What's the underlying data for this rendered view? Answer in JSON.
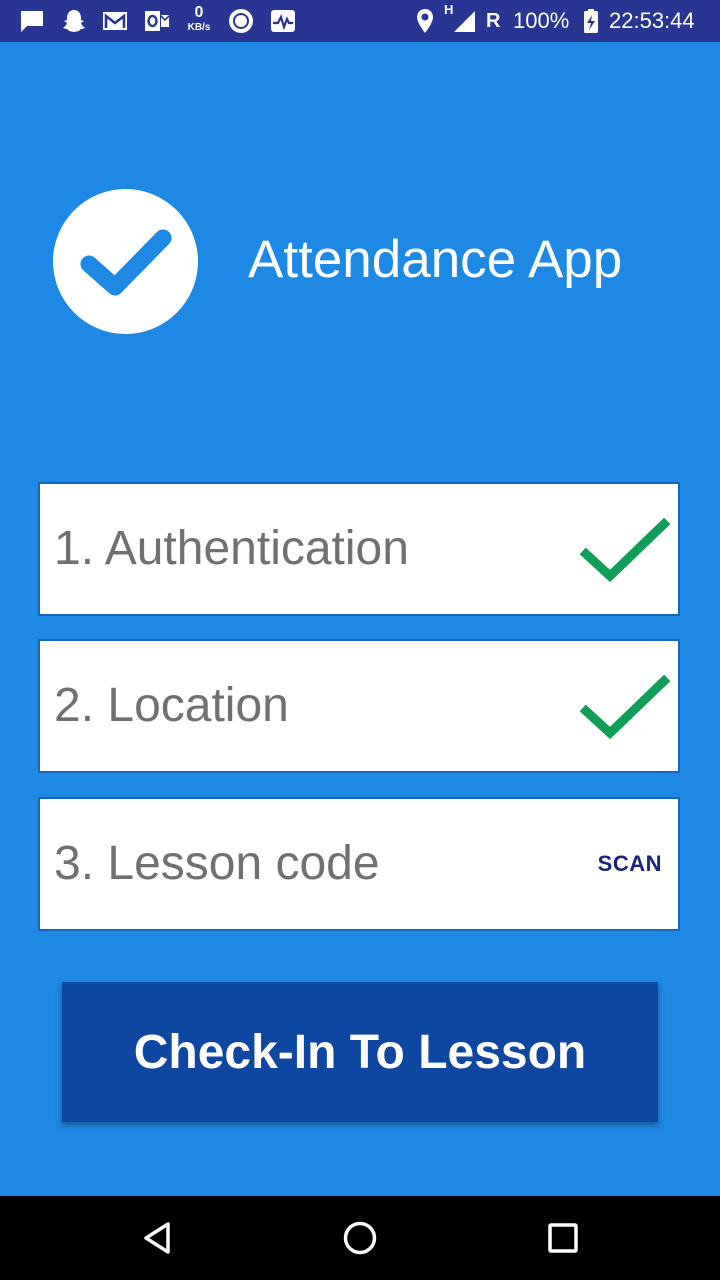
{
  "status_bar": {
    "icons": [
      "message-icon",
      "snapchat-icon",
      "gmail-icon",
      "outlook-icon",
      "network-speed-icon",
      "circle-app-icon",
      "activity-icon",
      "location-icon",
      "signal-icon",
      "battery-charging-icon"
    ],
    "net_speed_value": "0",
    "net_speed_unit": "KB/s",
    "network_type": "H",
    "roaming": "R",
    "battery": "100%",
    "time": "22:53:44"
  },
  "header": {
    "title": "Attendance App",
    "logo_icon": "checkmark-circle-icon"
  },
  "steps": [
    {
      "label": "1. Authentication",
      "status": "done",
      "status_icon": "green-check-icon"
    },
    {
      "label": "2. Location",
      "status": "done",
      "status_icon": "green-check-icon"
    },
    {
      "label": "3. Lesson code",
      "action_label": "SCAN"
    }
  ],
  "checkin": {
    "label": "Check-In To Lesson"
  },
  "nav": {
    "icons": [
      "back-icon",
      "home-icon",
      "recents-icon"
    ]
  },
  "colors": {
    "background": "#1E88E5",
    "status_bar": "#283593",
    "button": "#0D47A1",
    "check_green": "#0F9D58",
    "step_text": "#707070",
    "scan_text": "#1A237E"
  }
}
